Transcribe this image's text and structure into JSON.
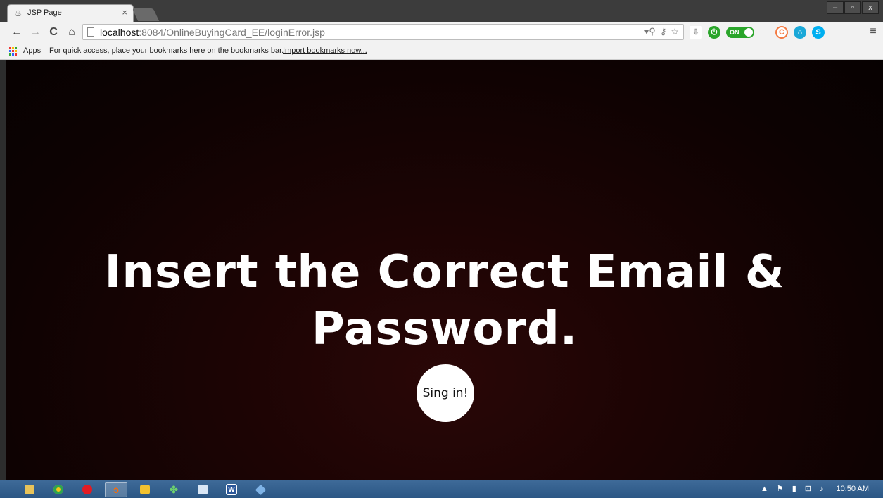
{
  "window": {
    "tab_title": "JSP Page",
    "tab_close": "×",
    "controls": {
      "minimize": "–",
      "maximize": "▫",
      "close": "x"
    }
  },
  "toolbar": {
    "back": "←",
    "forward": "→",
    "reload": "C",
    "home": "⌂",
    "url_host": "localhost",
    "url_rest": ":8084/OnlineBuyingCard_EE/loginError.jsp",
    "ext_toggle_label": "ON",
    "menu": "≡"
  },
  "bookmarks": {
    "apps_label": "Apps",
    "hint": "For quick access, place your bookmarks here on the bookmarks bar.",
    "import_link": "Import bookmarks now..."
  },
  "page": {
    "headline_line1": "Insert the Correct Email &",
    "headline_line2": "Password.",
    "button_label": "Sing in!"
  },
  "taskbar": {
    "clock": "10:50 AM",
    "icons": [
      "explorer-icon",
      "chrome-icon",
      "opera-icon",
      "netbeans-icon",
      "winamp-icon",
      "clover-icon",
      "window-icon",
      "word-icon",
      "virtualbox-icon"
    ]
  },
  "colors": {
    "page_background": "#1c0404",
    "button_bg": "#ffffff",
    "taskbar": "#2b5684"
  }
}
